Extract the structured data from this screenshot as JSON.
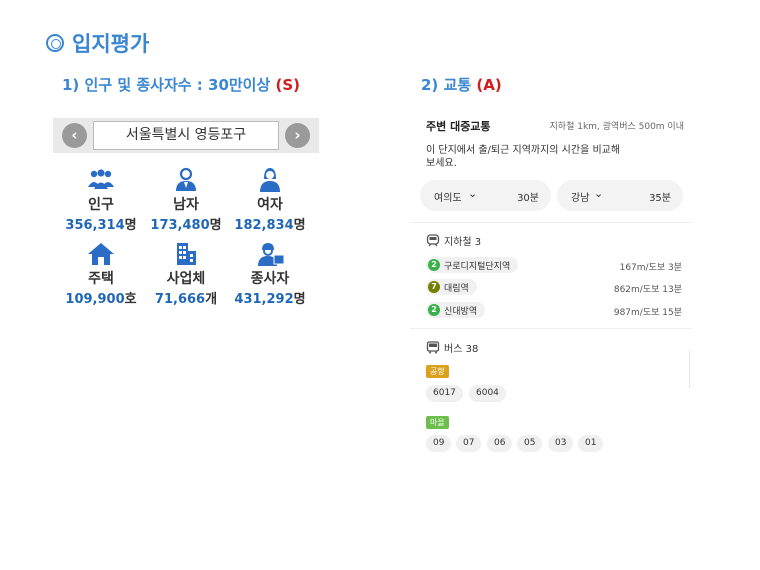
{
  "title": "입지평가",
  "left": {
    "heading_prefix": "1) 인구 및 종사자수 : 30만이상",
    "grade": "(S)",
    "prev_icon": "‹",
    "next_icon": "›",
    "region": "서울특별시 영등포구",
    "stats": [
      {
        "label": "인구",
        "value": "356,314",
        "unit": "명",
        "icon": "people-icon"
      },
      {
        "label": "남자",
        "value": "173,480",
        "unit": "명",
        "icon": "man-icon"
      },
      {
        "label": "여자",
        "value": "182,834",
        "unit": "명",
        "icon": "woman-icon"
      },
      {
        "label": "주택",
        "value": "109,900",
        "unit": "호",
        "icon": "house-icon"
      },
      {
        "label": "사업체",
        "value": "71,666",
        "unit": "개",
        "icon": "building-icon"
      },
      {
        "label": "종사자",
        "value": "431,292",
        "unit": "명",
        "icon": "worker-icon"
      }
    ],
    "colors": {
      "accent": "#3a86d4",
      "value": "#1f67b6",
      "grade": "#d21d1d",
      "icon": "#2b6cc4"
    }
  },
  "right": {
    "heading_prefix": "2) 교통",
    "grade": "(A)",
    "transit_title": "주변 대중교통",
    "transit_sub": "지하철 1km, 광역버스 500m 이내",
    "compare_text": "이 단지에서 출/퇴근 지역까지의 시간을 비교해보세요.",
    "destinations": [
      {
        "name": "여의도",
        "dropdown": "⌄",
        "time": "30분"
      },
      {
        "name": "강남",
        "dropdown": "⌄",
        "time": "35분"
      }
    ],
    "subway_label": "지하철 3",
    "stations": [
      {
        "line": "2",
        "line_color": "#3bb14a",
        "name": "구로디지털단지역",
        "distance": "167m/도보 3분"
      },
      {
        "line": "7",
        "line_color": "#747f00",
        "name": "대림역",
        "distance": "862m/도보 13분"
      },
      {
        "line": "2",
        "line_color": "#3bb14a",
        "name": "신대방역",
        "distance": "987m/도보 15분"
      }
    ],
    "bus_label": "버스 38",
    "bus_groups": [
      {
        "tag": "공항",
        "tag_color": "#d9a11c",
        "routes": [
          "6017",
          "6004"
        ]
      },
      {
        "tag": "마을",
        "tag_color": "#6bbf4a",
        "routes": [
          "09",
          "07",
          "06",
          "05",
          "03",
          "01"
        ]
      }
    ]
  }
}
